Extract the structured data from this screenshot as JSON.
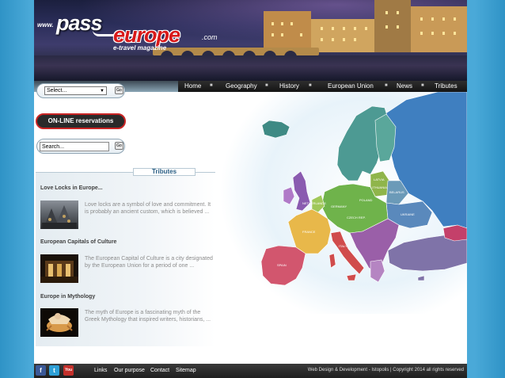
{
  "logo": {
    "www": "www.",
    "pass": "pass",
    "europe": "europe",
    "com": ".com",
    "tagline": "e-travel magazine"
  },
  "nav": {
    "items": [
      "Home",
      "Geography",
      "History",
      "European Union",
      "News",
      "Tributes"
    ]
  },
  "sidebar": {
    "select_value": "Select...",
    "select_go": "Go",
    "reservation_label": "ON-LINE reservations",
    "search_value": "Search...",
    "search_go": "Go"
  },
  "tributes": {
    "title": "Tributes",
    "items": [
      {
        "title": "Love Locks in Europe...",
        "text": "Love locks are a symbol of love and commitment. It is probably an ancient custom, which is believed ..."
      },
      {
        "title": "European Capitals of Culture",
        "text": "The European Capital of Culture is a city designated by the European Union for a period of one ..."
      },
      {
        "title": "Europe in Mythology",
        "text": "The myth of Europe is a fascinating myth of the Greek Mythology that inspired writers, historians, ..."
      }
    ]
  },
  "map": {
    "labels": {
      "latvia": "LATVIA",
      "lithuania": "LITHUANIA",
      "belarus": "BELARUS",
      "netherlands": "NETHERLANDS",
      "germany": "GERMANY",
      "poland": "POLAND",
      "czech": "CZECH REP.",
      "france": "FRANCE",
      "spain": "SPAIN",
      "italy": "ITALY",
      "ukraine": "UKRAINE"
    },
    "colors": {
      "sea": "#ffffff",
      "iceland": "#3e8a84",
      "uk": "#8a5bb0",
      "scandinavia": "#4d9a93",
      "russia": "#3f7fc0",
      "france": "#e8b84a",
      "iberia": "#d2566e",
      "central": "#6fb34b",
      "baltic": "#8fb54a",
      "italy": "#d04c4c",
      "balkans": "#9a5fa8",
      "turkey": "#7f73a8"
    }
  },
  "footer": {
    "social": [
      "f",
      "t",
      "You"
    ],
    "links": [
      "Links",
      "Our purpose",
      "Contact",
      "Sitemap"
    ],
    "credit": "Web Design & Development - Istopolis | Copyright 2014 all rights reserved"
  }
}
